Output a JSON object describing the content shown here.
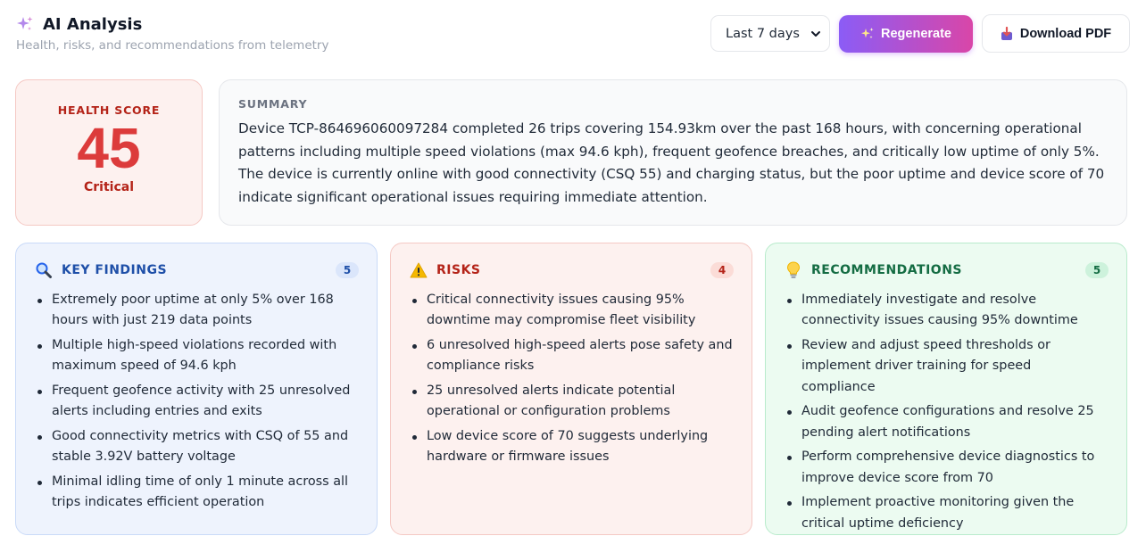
{
  "header": {
    "title": "AI Analysis",
    "title_icon": "sparkles-icon",
    "subtitle": "Health, risks, and recommendations from telemetry"
  },
  "controls": {
    "range_selected": "Last 7 days",
    "regenerate_label": "Regenerate",
    "regenerate_icon": "sparkles-icon",
    "download_label": "Download PDF",
    "download_icon": "pdf-download-icon"
  },
  "health": {
    "label": "HEALTH SCORE",
    "value": "45",
    "status": "Critical",
    "color": "#dc3b3b"
  },
  "summary": {
    "label": "SUMMARY",
    "text": "Device TCP-864696060097284 completed 26 trips covering 154.93km over the past 168 hours, with concerning operational patterns including multiple speed violations (max 94.6 kph), frequent geofence breaches, and critically low uptime of only 5%. The device is currently online with good connectivity (CSQ 55) and charging status, but the poor uptime and device score of 70 indicate significant operational issues requiring immediate attention."
  },
  "findings": {
    "title": "KEY FINDINGS",
    "icon": "magnifier-icon",
    "count": "5",
    "items": [
      "Extremely poor uptime at only 5% over 168 hours with just 219 data points",
      "Multiple high-speed violations recorded with maximum speed of 94.6 kph",
      "Frequent geofence activity with 25 unresolved alerts including entries and exits",
      "Good connectivity metrics with CSQ of 55 and stable 3.92V battery voltage",
      "Minimal idling time of only 1 minute across all trips indicates efficient operation"
    ]
  },
  "risks": {
    "title": "RISKS",
    "icon": "warning-icon",
    "count": "4",
    "items": [
      "Critical connectivity issues causing 95% downtime may compromise fleet visibility",
      "6 unresolved high-speed alerts pose safety and compliance risks",
      "25 unresolved alerts indicate potential operational or configuration problems",
      "Low device score of 70 suggests underlying hardware or firmware issues"
    ]
  },
  "recommendations": {
    "title": "RECOMMENDATIONS",
    "icon": "lightbulb-icon",
    "count": "5",
    "items": [
      "Immediately investigate and resolve connectivity issues causing 95% downtime",
      "Review and adjust speed thresholds or implement driver training for speed compliance",
      "Audit geofence configurations and resolve 25 pending alert notifications",
      "Perform comprehensive device diagnostics to improve device score from 70",
      "Implement proactive monitoring given the critical uptime deficiency"
    ]
  },
  "colors": {
    "accent_gradient_start": "#8b5cf6",
    "accent_gradient_end": "#d946a8",
    "critical": "#dc3b3b",
    "findings_accent": "#1e4fa8",
    "risks_accent": "#b42318",
    "recs_accent": "#146c43"
  }
}
